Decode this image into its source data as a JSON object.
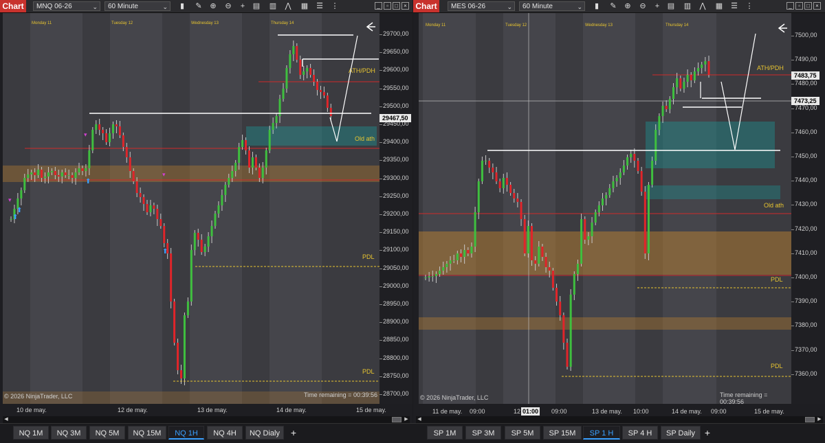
{
  "left": {
    "chart_label": "Chart",
    "instrument": "MNQ 06-26",
    "timeframe": "60 Minute",
    "day_labels": [
      "Monday 11",
      "Tuesday 12",
      "Wednesday 13",
      "Thursday 14"
    ],
    "y_ticks": [
      "29700,00",
      "29650,00",
      "29600,00",
      "29550,00",
      "29500,00",
      "29450,00",
      "29400,00",
      "29350,00",
      "29300,00",
      "29250,00",
      "29200,00",
      "29150,00",
      "29100,00",
      "29050,00",
      "29000,00",
      "28950,00",
      "28900,00",
      "28850,00",
      "28800,00",
      "28750,00",
      "28700,00"
    ],
    "price_tag": "29467,50",
    "x_labels": [
      "10 de may.",
      "12 de may.",
      "13 de may.",
      "14 de may.",
      "15 de may."
    ],
    "annotations": {
      "ath": "ATH/PDH",
      "old_ath": "Old ath",
      "pdl1": "PDL",
      "pdl2": "PDL"
    },
    "copyright": "© 2026 NinjaTrader, LLC",
    "time_remaining": "Time remaining = 00:39:56",
    "tabs": [
      "NQ 1M",
      "NQ 3M",
      "NQ 5M",
      "NQ 15M",
      "NQ 1H",
      "NQ 4H",
      "NQ Dialy"
    ],
    "active_tab": "NQ 1H"
  },
  "right": {
    "chart_label": "Chart",
    "instrument": "MES 06-26",
    "timeframe": "60 Minute",
    "day_labels": [
      "Monday 11",
      "Tuesday 12",
      "Wednesday 13",
      "Thursday 14"
    ],
    "y_ticks": [
      "7500,00",
      "7490,00",
      "7480,00",
      "7470,00",
      "7460,00",
      "7450,00",
      "7440,00",
      "7430,00",
      "7420,00",
      "7410,00",
      "7400,00",
      "7390,00",
      "7380,00",
      "7370,00",
      "7360,00"
    ],
    "price_tag_1": "7483,75",
    "price_tag_2": "7473,25",
    "x_labels": [
      "11 de may.",
      "09:00",
      "12",
      "01:00",
      "09:00",
      "13 de may.",
      "10:00",
      "14 de may.",
      "09:00",
      "15 de may."
    ],
    "annotations": {
      "ath": "ATH/PDH",
      "old_ath": "Old ath",
      "pdl1": "PDL",
      "pdl2": "PDL"
    },
    "copyright": "© 2026 NinjaTrader, LLC",
    "time_remaining": "Time remaining = 00:39:56",
    "tabs": [
      "SP 1M",
      "SP 3M",
      "SP 5M",
      "SP 15M",
      "SP 1 H",
      "SP 4 H",
      "SP Daily"
    ],
    "active_tab": "SP 1 H"
  },
  "toolbar_icons": [
    "bar-chart-icon",
    "pencil-icon",
    "zoom-in-icon",
    "zoom-out-icon",
    "crosshair-icon",
    "data-box-icon",
    "strategy-icon",
    "indicator-icon",
    "properties-icon",
    "list-icon"
  ],
  "add_tab_label": "+",
  "colors": {
    "up": "#3fbf3f",
    "down": "#e0252a",
    "accent_red": "#c8322d",
    "zone_orange": "#c8872e",
    "zone_teal": "#1f8f8f",
    "annotation": "#e8c530",
    "active_tab": "#3aa0ff"
  }
}
